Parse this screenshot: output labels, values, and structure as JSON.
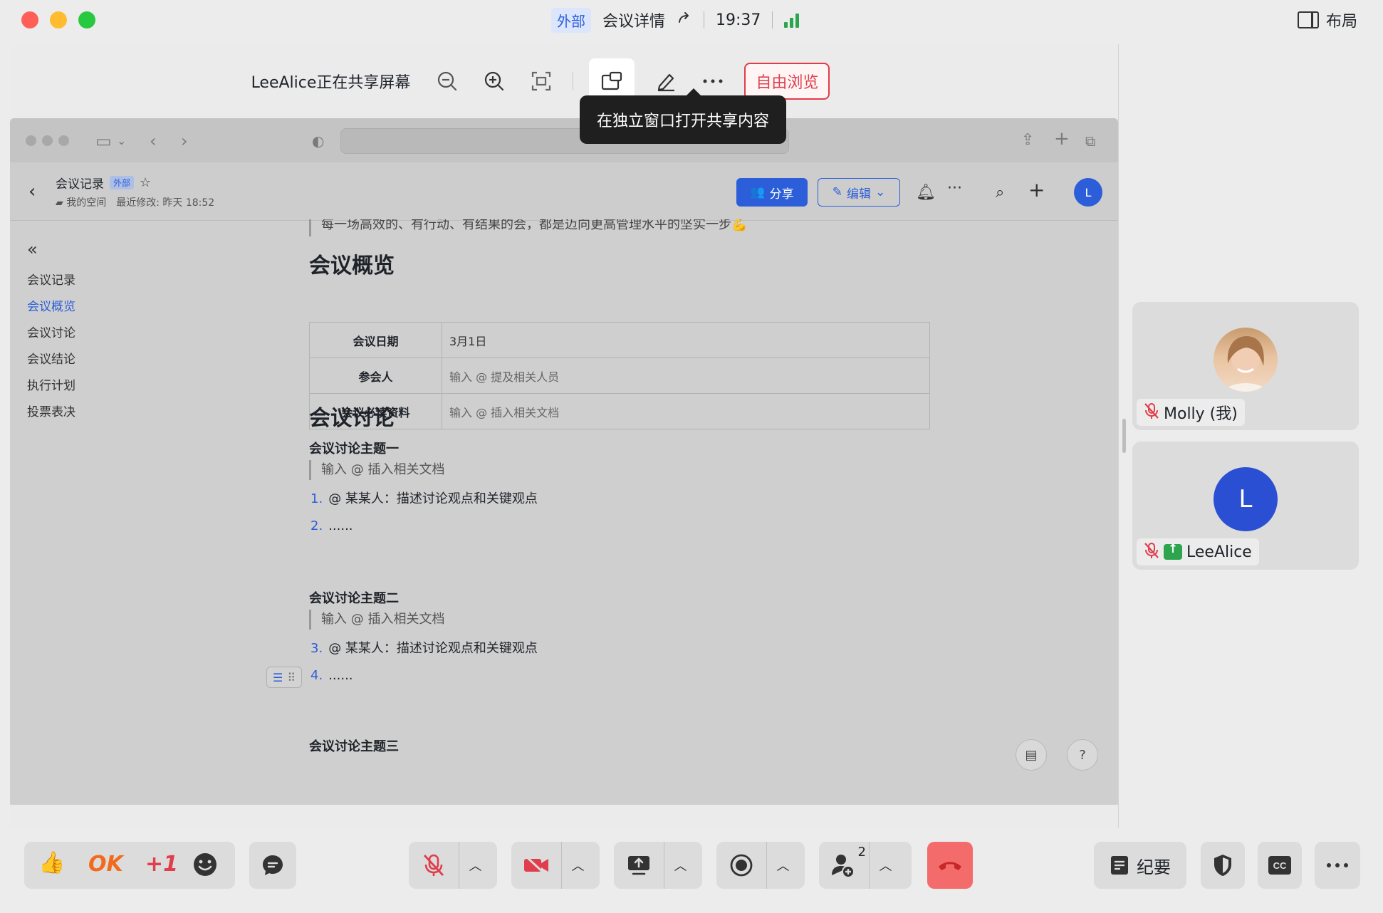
{
  "titlebar": {
    "external_badge": "外部",
    "title": "会议详情",
    "time": "19:37",
    "layout_label": "布局"
  },
  "share_toolbar": {
    "sharer_text": "LeeAlice正在共享屏幕",
    "free_browse_label": "自由浏览",
    "tooltip": "在独立窗口打开共享内容"
  },
  "doc": {
    "title": "会议记录",
    "external_badge": "外部",
    "space": "我的空间",
    "last_modified": "最近修改: 昨天 18:52",
    "share_label": "分享",
    "edit_label": "编辑",
    "avatar_letter": "L",
    "outline": [
      "会议记录",
      "会议概览",
      "会议讨论",
      "会议结论",
      "执行计划",
      "投票表决"
    ],
    "outline_active": "会议概览",
    "top_quote": "每一场高效的、有行动、有结果的会，都是迈向更高管理水平的坚实一步💪",
    "overview_heading": "会议概览",
    "table": [
      {
        "key": "会议日期",
        "value": "3月1日"
      },
      {
        "key": "参会人",
        "value": "输入 @ 提及相关人员"
      },
      {
        "key": "会议必读资料",
        "value": "输入 @ 插入相关文档"
      }
    ],
    "discussion_heading": "会议讨论",
    "topic1": {
      "title": "会议讨论主题一",
      "quote": "输入 @ 插入相关文档",
      "items": [
        {
          "n": "1.",
          "text": "@ 某某人：描述讨论观点和关键观点"
        },
        {
          "n": "2.",
          "text": "......"
        }
      ]
    },
    "topic2": {
      "title": "会议讨论主题二",
      "quote": "输入 @ 插入相关文档",
      "items": [
        {
          "n": "3.",
          "text": "@ 某某人：描述讨论观点和关键观点"
        },
        {
          "n": "4.",
          "text": "......"
        }
      ]
    },
    "topic3": {
      "title": "会议讨论主题三"
    }
  },
  "participants": [
    {
      "name": "Molly (我)",
      "muted": true
    },
    {
      "name": "LeeAlice",
      "muted": true,
      "sharing": true,
      "avatar_letter": "L"
    }
  ],
  "bottombar": {
    "react_ok": "OK",
    "react_plus1": "+1",
    "participant_count": "2",
    "minutes_label": "纪要"
  },
  "colors": {
    "accent": "#2b5ed8",
    "danger": "#e03e4c",
    "hangup": "#f46b6b",
    "signal": "#2da44e"
  }
}
